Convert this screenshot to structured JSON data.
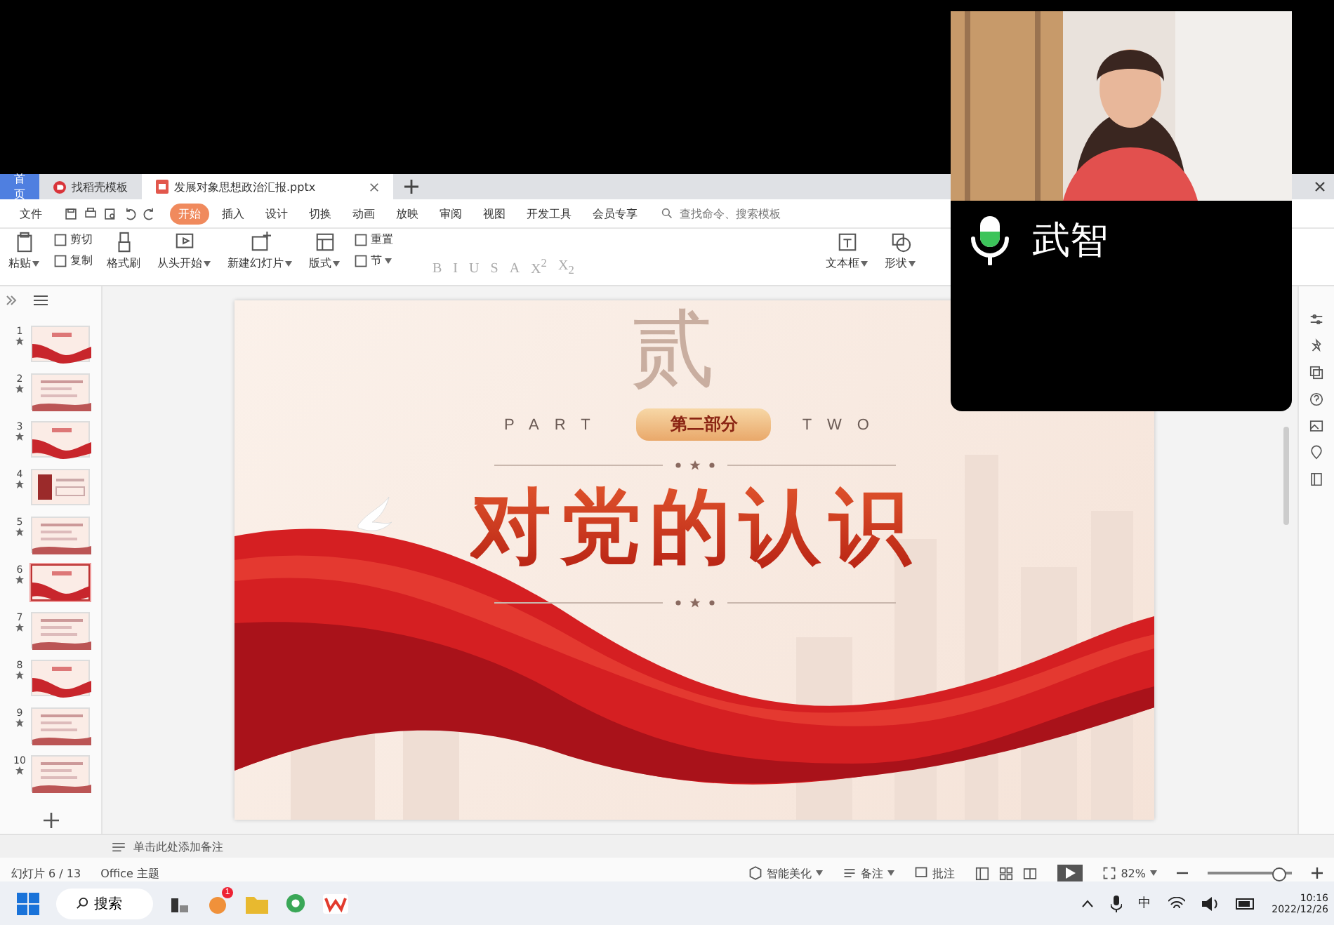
{
  "tabs": [
    {
      "label": "首页",
      "kind": "home",
      "selected": false
    },
    {
      "label": "找稻壳模板",
      "kind": "template",
      "selected": false
    },
    {
      "label": "发展对象思想政治汇报.pptx",
      "kind": "document",
      "selected": true
    }
  ],
  "menu": [
    {
      "label": "文件",
      "selected": false
    },
    {
      "label": "开始",
      "selected": true
    },
    {
      "label": "插入",
      "selected": false
    },
    {
      "label": "设计",
      "selected": false
    },
    {
      "label": "切换",
      "selected": false
    },
    {
      "label": "动画",
      "selected": false
    },
    {
      "label": "放映",
      "selected": false
    },
    {
      "label": "审阅",
      "selected": false
    },
    {
      "label": "视图",
      "selected": false
    },
    {
      "label": "开发工具",
      "selected": false
    },
    {
      "label": "会员专享",
      "selected": false
    }
  ],
  "search": {
    "placeholder": "查找命令、搜索模板"
  },
  "toolbar": [
    {
      "kind": "large",
      "label": "粘贴",
      "dropdown": true
    },
    {
      "kind": "stack",
      "items": [
        {
          "label": "剪切",
          "dropdown": false
        },
        {
          "label": "复制",
          "dropdown": false
        }
      ]
    },
    {
      "kind": "large",
      "label": "格式刷",
      "dropdown": false
    },
    {
      "kind": "large",
      "label": "从头开始",
      "dropdown": true
    },
    {
      "kind": "large",
      "label": "新建幻灯片",
      "dropdown": true
    },
    {
      "kind": "large",
      "label": "版式",
      "dropdown": true
    },
    {
      "kind": "stack",
      "items": [
        {
          "label": "重置",
          "dropdown": false
        },
        {
          "label": "节",
          "dropdown": true
        }
      ]
    },
    {
      "kind": "format",
      "items": [
        "B",
        "I",
        "U",
        "S",
        "A",
        "X$^{2}$",
        "X$_{2}$"
      ]
    },
    {
      "kind": "large",
      "label": "文本框",
      "dropdown": true
    },
    {
      "kind": "large",
      "label": "形状",
      "dropdown": true
    }
  ],
  "thumbnails": [
    {
      "number": "1",
      "kind": "ribbon",
      "selected": false
    },
    {
      "number": "2",
      "kind": "text",
      "selected": false
    },
    {
      "number": "3",
      "kind": "ribbon",
      "selected": false
    },
    {
      "number": "4",
      "selected": false
    },
    {
      "number": "5",
      "kind": "text",
      "selected": false
    },
    {
      "number": "6",
      "kind": "ribbon",
      "selected": true
    },
    {
      "number": "7",
      "kind": "text",
      "selected": false
    },
    {
      "number": "8",
      "kind": "ribbon",
      "selected": false
    },
    {
      "number": "9",
      "kind": "text",
      "selected": false
    },
    {
      "number": "10",
      "kind": "text",
      "selected": false
    }
  ],
  "slide": {
    "watermark": "贰",
    "part_left": "PART",
    "badge": "第二部分",
    "part_right": "TWO",
    "title": "对党的认识"
  },
  "notes": {
    "placeholder": "单击此处添加备注"
  },
  "status_bar": {
    "slide_counter": "幻灯片 6 / 13",
    "theme": "Office 主题",
    "beautify": "智能美化",
    "notes": "备注",
    "comments": "批注",
    "zoom": "82%",
    "zoom_level": {
      "level": 0.85
    }
  },
  "video": {
    "name": "武智",
    "mic": {
      "level": 0.5
    }
  },
  "taskbar": {
    "search": "搜索",
    "badge": "1",
    "ime": "中",
    "time": "10:16",
    "date": "2022/12/26"
  }
}
